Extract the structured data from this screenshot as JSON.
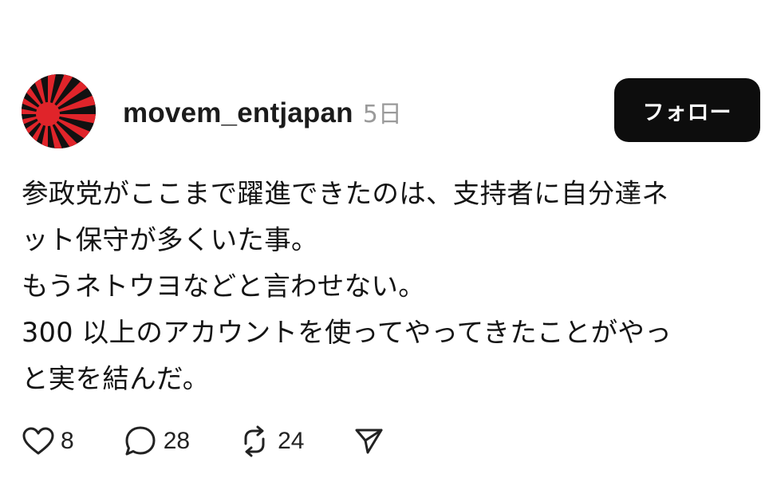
{
  "post": {
    "username": "movem_entjapan",
    "time": "5日",
    "follow_label": "フォロー",
    "body_lines": [
      "参政党がここまで躍進できたのは、支持者に自分達ネ",
      "ット保守が多くいた事。",
      "もうネトウヨなどと言わせない。",
      "300 以上のアカウントを使ってやってきたことがやっ",
      "と実を結んだ。"
    ],
    "likes": "8",
    "replies": "28",
    "reposts": "24"
  },
  "icons": {
    "avatar": "rising-sun-flag-avatar",
    "like": "heart-icon",
    "reply": "speech-bubble-icon",
    "repost": "repost-arrows-icon",
    "share": "paper-plane-icon"
  },
  "colors": {
    "follow_button_bg": "#0d0d0d",
    "follow_button_text": "#ffffff",
    "timestamp": "#9a9a9a",
    "avatar_red": "#e0242a"
  }
}
